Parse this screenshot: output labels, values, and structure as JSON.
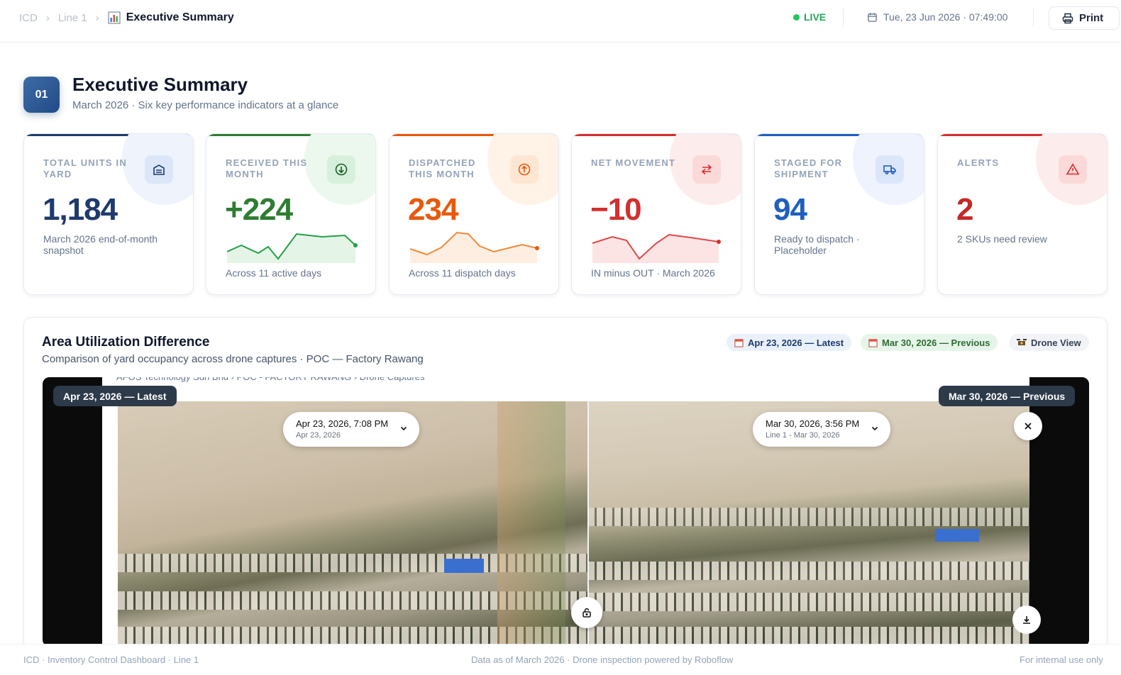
{
  "breadcrumb": {
    "items": [
      "ICD",
      "Line 1"
    ],
    "current": "Executive Summary"
  },
  "status": {
    "live_label": "LIVE",
    "datetime": "Tue, 23 Jun 2026 · 07:49:00",
    "print_label": "Print"
  },
  "section": {
    "number": "01",
    "title": "Executive Summary",
    "subtitle": "March 2026 · Six key performance indicators at a glance"
  },
  "kpis": [
    {
      "label": "TOTAL UNITS IN YARD",
      "value": "1,184",
      "note": "March 2026 end-of-month snapshot",
      "color": "#1e3a6e",
      "accent": "#1e3a6e",
      "icon": "warehouse-icon"
    },
    {
      "label": "RECEIVED THIS MONTH",
      "value": "+224",
      "note": "Across 11 active days",
      "color": "#2e7d32",
      "accent": "#2e7d32",
      "icon": "arrow-down-circle-icon"
    },
    {
      "label": "DISPATCHED THIS MONTH",
      "value": "234",
      "note": "Across 11 dispatch days",
      "color": "#e8590c",
      "accent": "#e8590c",
      "icon": "arrow-up-circle-icon"
    },
    {
      "label": "NET MOVEMENT",
      "value": "−10",
      "note": "IN minus OUT · March 2026",
      "color": "#d32f2f",
      "accent": "#d32f2f",
      "icon": "swap-arrows-icon"
    },
    {
      "label": "STAGED FOR SHIPMENT",
      "value": "94",
      "note": "Ready to dispatch · Placeholder",
      "color": "#1f5fbf",
      "accent": "#1f5fbf",
      "icon": "truck-icon"
    },
    {
      "label": "ALERTS",
      "value": "2",
      "note": "2 SKUs need review",
      "color": "#c62828",
      "accent": "#d32f2f",
      "icon": "warning-triangle-icon"
    }
  ],
  "panel": {
    "title": "Area Utilization Difference",
    "subtitle": "Comparison of yard occupancy across drone captures · POC — Factory Rawang",
    "chips": [
      "Apr 23, 2026 — Latest",
      "Mar 30, 2026 — Previous",
      "Drone View"
    ],
    "capture_breadcrumb": "AFOS Technology Sdn Bhd  ›  POC - FACTORY RAWANG  ›  Drone Captures",
    "left_label": "Apr 23, 2026 — Latest",
    "right_label": "Mar 30, 2026 — Previous",
    "left_picker": {
      "primary": "Apr 23, 2026, 7:08 PM",
      "secondary": "Apr 23, 2026"
    },
    "right_picker": {
      "primary": "Mar 30, 2026, 3:56 PM",
      "secondary": "Line 1 - Mar 30, 2026"
    }
  },
  "footer": {
    "left": "ICD · Inventory Control Dashboard · Line 1",
    "center": "Data as of March 2026 · Drone inspection powered by Roboflow",
    "right": "For internal use only"
  }
}
